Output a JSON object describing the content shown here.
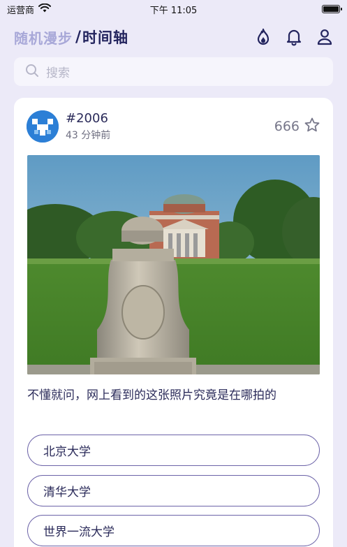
{
  "status_bar": {
    "carrier": "运营商",
    "time": "下午 11:05",
    "wifi_icon": "wifi-icon",
    "battery_level": 1.0
  },
  "header": {
    "tab_random": "随机漫步",
    "separator": "/",
    "tab_timeline": "时间轴",
    "icons": [
      "fire-icon",
      "bell-icon",
      "user-icon"
    ]
  },
  "search": {
    "placeholder": "搜索",
    "icon": "search-icon"
  },
  "post": {
    "id": "#2006",
    "time_ago": "43 分钟前",
    "star_count": "666",
    "star_icon": "star-icon",
    "question": "不懂就问，网上看到的这张照片究竟是在哪拍的",
    "options": [
      "北京大学",
      "清华大学",
      "世界一流大学"
    ]
  },
  "colors": {
    "background": "#ECEAF8",
    "accent": "#23245E",
    "inactive_tab": "#A8A8D8",
    "option_border": "#6C63A8",
    "avatar": "#2C7FD6"
  }
}
